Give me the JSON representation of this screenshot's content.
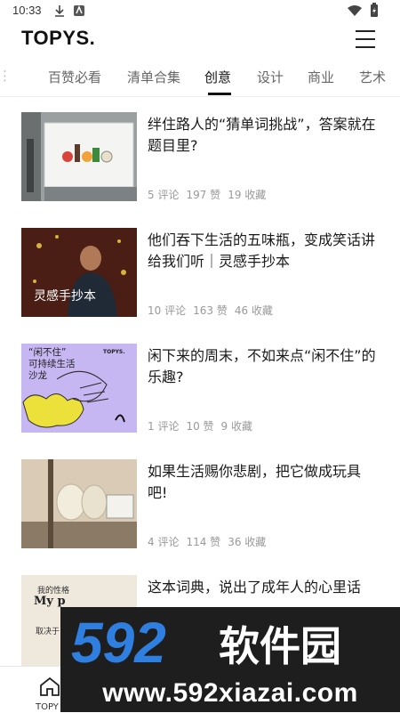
{
  "status_bar": {
    "time": "10:33"
  },
  "app": {
    "logo": "TOPYS."
  },
  "tabs": [
    {
      "label": "百赞必看"
    },
    {
      "label": "清单合集"
    },
    {
      "label": "创意",
      "active": true
    },
    {
      "label": "设计"
    },
    {
      "label": "商业"
    },
    {
      "label": "艺术"
    }
  ],
  "articles": [
    {
      "title": "绊住路人的“猜单词挑战”，答案就在题目里?",
      "comments": "5 评论",
      "likes": "197 赞",
      "favorites": "19 收藏"
    },
    {
      "title": "他们吞下生活的五味瓶，变成笑话讲给我们听｜灵感手抄本",
      "comments": "10 评论",
      "likes": "163 赞",
      "favorites": "46 收藏",
      "thumb_text": "灵感手抄本"
    },
    {
      "title": "闲下来的周末，不如来点“闲不住”的乐趣?",
      "comments": "1 评论",
      "likes": "10 赞",
      "favorites": "9 收藏",
      "thumb_text": "“闲不住”\n可持续生活\n沙龙",
      "thumb_brand": "TOPYS."
    },
    {
      "title": "如果生活赐你悲剧，把它做成玩具吧!",
      "comments": "4 评论",
      "likes": "114 赞",
      "favorites": "36 收藏"
    },
    {
      "title": "这本词典，说出了成年人的心里话",
      "thumb_text_1": "我的性格",
      "thumb_text_2": "My p",
      "thumb_text_3": "取决于"
    }
  ],
  "bottom_nav": {
    "home_label": "TOPY"
  },
  "watermark": {
    "brand": "592软件园",
    "url": "www.592xiazai.com"
  },
  "colors": {
    "watermark_blue": "#2f7fe0",
    "watermark_bg": "#1e1e1e"
  }
}
